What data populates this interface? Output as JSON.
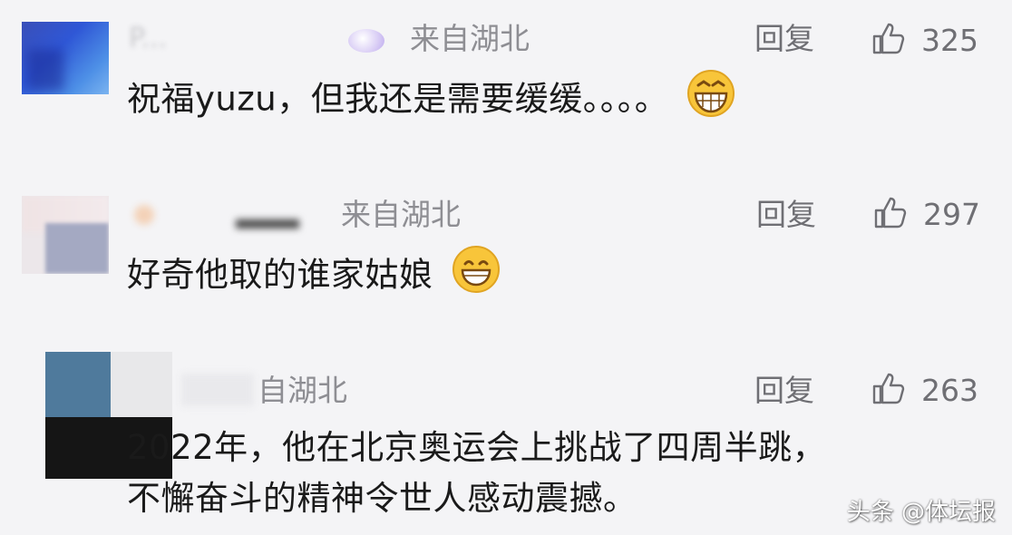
{
  "comments": [
    {
      "username": "P...",
      "location": "来自湖北",
      "reply_label": "回复",
      "like_count": "325",
      "text": "祝福yuzu，但我还是需要缓缓。。。。",
      "emoji": "grinning-face-with-big-eyes-emoji"
    },
    {
      "location": "来自湖北",
      "reply_label": "回复",
      "like_count": "297",
      "text": "好奇他取的谁家姑娘",
      "emoji": "grinning-face-emoji"
    },
    {
      "location": "自湖北",
      "reply_label": "回复",
      "like_count": "263",
      "text_lines": [
        "2022年，他在北京奥运会上挑战了四周半跳，",
        "不懈奋斗的精神令世人感动震撼。"
      ]
    }
  ],
  "watermark": "头条 @体坛报",
  "colors": {
    "background": "#f4f4f6",
    "meta_text": "#8e8e93",
    "action_text": "#6f6f74",
    "body_text": "#1a1a1a"
  }
}
